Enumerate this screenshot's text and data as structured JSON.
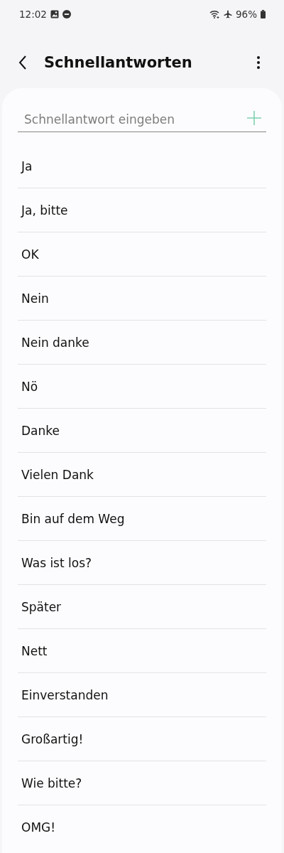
{
  "status_bar": {
    "time": "12:02",
    "battery": "96%"
  },
  "header": {
    "title": "Schnellantworten"
  },
  "input": {
    "placeholder": "Schnellantwort eingeben"
  },
  "replies": [
    "Ja",
    "Ja, bitte",
    "OK",
    "Nein",
    "Nein danke",
    "Nö",
    "Danke",
    "Vielen Dank",
    "Bin auf dem Weg",
    "Was ist los?",
    "Später",
    "Nett",
    "Einverstanden",
    "Großartig!",
    "Wie bitte?",
    "OMG!"
  ]
}
